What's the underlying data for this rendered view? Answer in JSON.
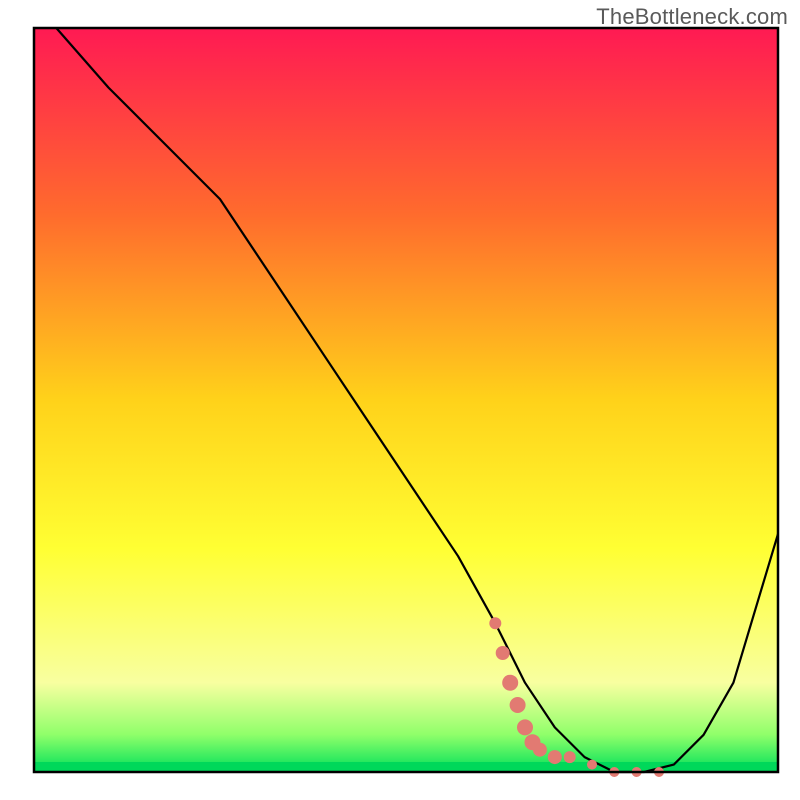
{
  "watermark": "TheBottleneck.com",
  "chart_data": {
    "type": "line",
    "title": "",
    "xlabel": "",
    "ylabel": "",
    "xlim": [
      0,
      100
    ],
    "ylim": [
      0,
      100
    ],
    "background_gradient": {
      "stops": [
        {
          "offset": 0.0,
          "color": "#ff1a53"
        },
        {
          "offset": 0.25,
          "color": "#ff6b2d"
        },
        {
          "offset": 0.5,
          "color": "#ffd21a"
        },
        {
          "offset": 0.7,
          "color": "#ffff33"
        },
        {
          "offset": 0.88,
          "color": "#f8ffa0"
        },
        {
          "offset": 0.95,
          "color": "#8fff6a"
        },
        {
          "offset": 1.0,
          "color": "#00e05a"
        }
      ]
    },
    "series": [
      {
        "name": "bottleneck-curve",
        "color": "#000000",
        "x": [
          3,
          10,
          18,
          25,
          33,
          41,
          49,
          57,
          62,
          66,
          70,
          74,
          78,
          82,
          86,
          90,
          94,
          100
        ],
        "y": [
          100,
          92,
          84,
          77,
          65,
          53,
          41,
          29,
          20,
          12,
          6,
          2,
          0,
          0,
          1,
          5,
          12,
          32
        ]
      }
    ],
    "highlight_points": {
      "name": "optimal-zone-markers",
      "color": "#e27a72",
      "points": [
        {
          "x": 62,
          "y": 20,
          "r": 6
        },
        {
          "x": 63,
          "y": 16,
          "r": 7
        },
        {
          "x": 64,
          "y": 12,
          "r": 8
        },
        {
          "x": 65,
          "y": 9,
          "r": 8
        },
        {
          "x": 66,
          "y": 6,
          "r": 8
        },
        {
          "x": 67,
          "y": 4,
          "r": 8
        },
        {
          "x": 68,
          "y": 3,
          "r": 7
        },
        {
          "x": 70,
          "y": 2,
          "r": 7
        },
        {
          "x": 72,
          "y": 2,
          "r": 6
        },
        {
          "x": 75,
          "y": 1,
          "r": 5
        },
        {
          "x": 78,
          "y": 0,
          "r": 5
        },
        {
          "x": 81,
          "y": 0,
          "r": 5
        },
        {
          "x": 84,
          "y": 0,
          "r": 5
        }
      ]
    }
  }
}
